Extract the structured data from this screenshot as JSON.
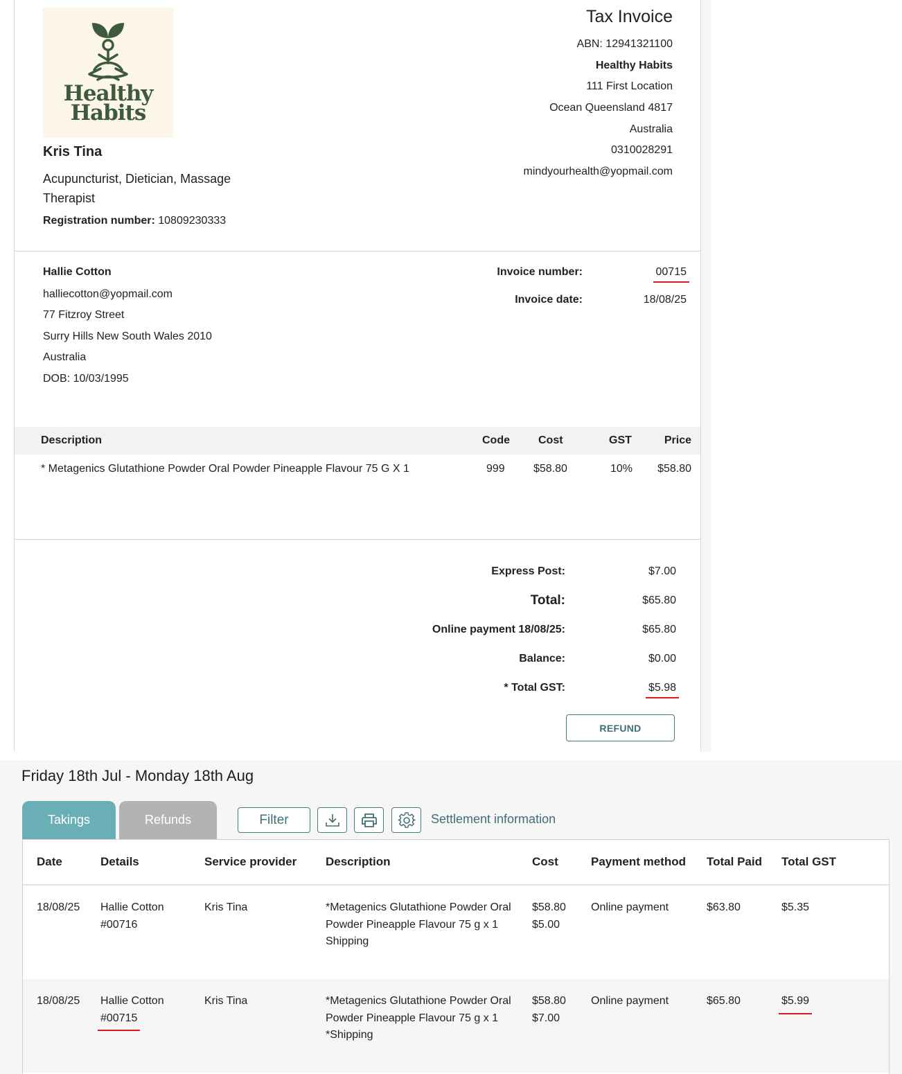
{
  "provider": {
    "logo_line1": "Healthy",
    "logo_line2": "Habits",
    "name": "Kris Tina",
    "role": "Acupuncturist, Dietician, Massage Therapist",
    "registration_label": "Registration number:",
    "registration_number": "10809230333"
  },
  "business": {
    "title": "Tax Invoice",
    "abn": "ABN: 12941321100",
    "name": "Healthy Habits",
    "address1": "111 First Location",
    "address2": "Ocean Queensland 4817",
    "country": "Australia",
    "phone": "0310028291",
    "email": "mindyourhealth@yopmail.com"
  },
  "client": {
    "name": "Hallie Cotton",
    "email": "halliecotton@yopmail.com",
    "address1": "77 Fitzroy Street",
    "address2": "Surry Hills New South Wales 2010",
    "country": "Australia",
    "dob": "DOB: 10/03/1995"
  },
  "invoice_meta": {
    "number_label": "Invoice number:",
    "number": "00715",
    "date_label": "Invoice date:",
    "date": "18/08/25"
  },
  "items": {
    "headers": {
      "description": "Description",
      "code": "Code",
      "cost": "Cost",
      "gst": "GST",
      "price": "Price"
    },
    "rows": [
      {
        "description": "* Metagenics Glutathione Powder Oral Powder Pineapple Flavour 75 G X 1",
        "code": "999",
        "cost": "$58.80",
        "gst": "10%",
        "price": "$58.80"
      }
    ]
  },
  "totals": [
    {
      "label": "Express Post:",
      "value": "$7.00"
    },
    {
      "label": "Total:",
      "value": "$65.80"
    },
    {
      "label": "Online payment 18/08/25:",
      "value": "$65.80"
    },
    {
      "label": "Balance:",
      "value": "$0.00"
    },
    {
      "label": "* Total GST:",
      "value": "$5.98"
    }
  ],
  "refund_label": "REFUND",
  "takings": {
    "date_range": "Friday 18th Jul - Monday 18th Aug",
    "tabs": [
      "Takings",
      "Refunds"
    ],
    "filter_label": "Filter",
    "settlement_label": "Settlement information",
    "headers": [
      "Date",
      "Details",
      "Service provider",
      "Description",
      "Cost",
      "Payment method",
      "Total Paid",
      "Total GST"
    ],
    "rows": [
      {
        "date": "18/08/25",
        "client": "Hallie Cotton",
        "invoice": "#00716",
        "provider": "Kris Tina",
        "description": "*Metagenics Glutathione Powder Oral Powder Pineapple Flavour 75 g x 1",
        "description2": "Shipping",
        "cost1": "$58.80",
        "cost2": "$5.00",
        "payment": "Online payment",
        "total_paid": "$63.80",
        "total_gst": "$5.35"
      },
      {
        "date": "18/08/25",
        "client": "Hallie Cotton",
        "invoice": "#00715",
        "provider": "Kris Tina",
        "description": "*Metagenics Glutathione Powder Oral Powder Pineapple Flavour 75 g x 1",
        "description2": "*Shipping",
        "cost1": "$58.80",
        "cost2": "$7.00",
        "payment": "Online payment",
        "total_paid": "$65.80",
        "total_gst": "$5.99"
      }
    ]
  },
  "colors": {
    "accent": "#6aafb6",
    "inactive_tab": "#b3b3b3",
    "highlight": "#e01818",
    "brand_green": "#3d5a3a"
  }
}
